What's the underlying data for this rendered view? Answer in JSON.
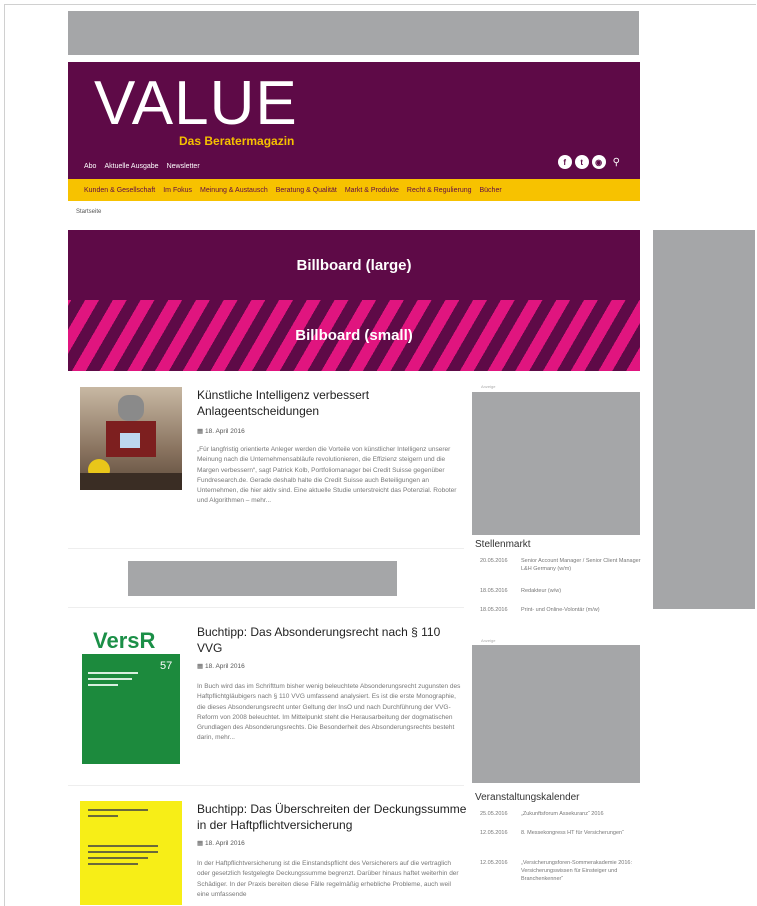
{
  "header": {
    "logo": "VALUE",
    "tagline": "Das Beratermagazin",
    "topnav": [
      "Abo",
      "Aktuelle Ausgabe",
      "Newsletter"
    ],
    "social": [
      "f",
      "t",
      "rss"
    ]
  },
  "mainnav": [
    "Kunden & Gesellschaft",
    "Im Fokus",
    "Meinung & Austausch",
    "Beratung & Qualität",
    "Markt & Produkte",
    "Recht & Regulierung",
    "Bücher"
  ],
  "breadcrumb": "Startseite",
  "billboard": {
    "large": "Billboard (large)",
    "small": "Billboard (small)"
  },
  "articles": [
    {
      "title": "Künstliche Intelligenz verbessert Anlageentscheidungen",
      "date": "18. April 2016",
      "text": "„Für langfristig orientierte Anleger werden die Vorteile von künstlicher Intelligenz unserer Meinung nach die Unternehmensabläufe revolutionieren, die Effizienz steigern und die Margen verbessern“, sagt Patrick Kolb, Portfoliomanager bei Credit Suisse gegenüber Fundresearch.de. Gerade deshalb halte die Credit Suisse auch Beteiligungen an Unternehmen, die hier aktiv sind. Eine aktuelle Studie unterstreicht das Potenzial. Roboter und Algorithmen – mehr..."
    },
    {
      "title": "Buchtipp: Das Absonderungsrecht nach § 110 VVG",
      "date": "18. April 2016",
      "text": "In Buch wird das im Schrifttum bisher wenig beleuchtete Absonderungsrecht zugunsten des Haftpflichtgläubigers nach § 110 VVG umfassend analysiert. Es ist die erste Monographie, die dieses Absonderungsrecht unter Geltung der InsO und nach Durchführung der VVG-Reform von 2008 beleuchtet. Im Mittelpunkt steht die Herausarbeitung der dogmatischen Grundlagen des Absonderungsrechts. Die Besonderheit des Absonderungsrechts besteht darin, mehr..."
    },
    {
      "title": "Buchtipp: Das Überschreiten der Deckungssumme in der Haftpflichtversicherung",
      "date": "18. April 2016",
      "text": "In der Haftpflichtversicherung ist die Einstandspflicht des Versicherers auf die vertraglich oder gesetzlich festgelegte Deckungssumme begrenzt. Darüber hinaus haftet weiterhin der Schädiger. In der Praxis bereiten diese Fälle regelmäßig erhebliche Probleme, auch weil eine umfassende"
    }
  ],
  "book_versr": {
    "brand": "VersR",
    "number": "57"
  },
  "sidebar": {
    "ad_label": "Anzeige",
    "jobs": {
      "title": "Stellenmarkt",
      "items": [
        {
          "date": "20.05.2016",
          "text": "Senior Account Manager / Senior Client Manager L&H Germany (w/m)"
        },
        {
          "date": "18.05.2016",
          "text": "Redakteur (w/w)"
        },
        {
          "date": "18.05.2016",
          "text": "Print- und Online-Volontär (m/w)"
        }
      ]
    },
    "events": {
      "title": "Veranstaltungskalender",
      "items": [
        {
          "date": "25.05.2016",
          "text": "„Zukunftsforum Assekuranz“ 2016"
        },
        {
          "date": "12.05.2016",
          "text": "8. Messekongress HT für Versicherungen“"
        },
        {
          "date": "12.05.2016",
          "text": "„Versicherungsforen-Sommerakademie 2016: Versicherungswissen für Einsteiger und Branchenkenner“"
        }
      ]
    }
  }
}
